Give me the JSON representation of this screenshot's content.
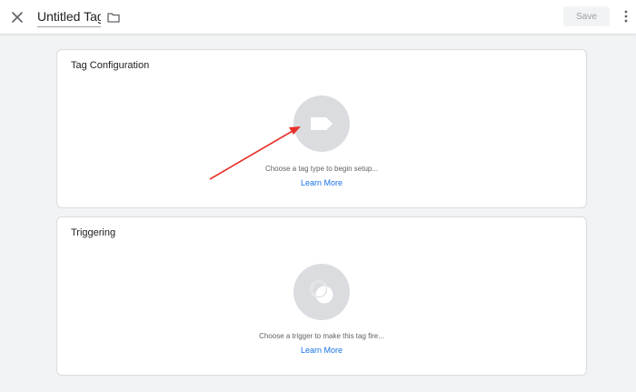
{
  "header": {
    "title": "Untitled Tag",
    "save_label": "Save",
    "icons": {
      "close": "close-icon",
      "folder": "folder-icon",
      "more": "more-vert-icon"
    }
  },
  "tag_configuration": {
    "title": "Tag Configuration",
    "hint": "Choose a tag type to begin setup...",
    "learn_more": "Learn More",
    "icon": "tag-icon"
  },
  "triggering": {
    "title": "Triggering",
    "hint": "Choose a trigger to make this tag fire...",
    "learn_more": "Learn More",
    "icon": "trigger-icon"
  },
  "colors": {
    "background": "#f1f3f4",
    "card": "#ffffff",
    "link": "#1a73e8",
    "placeholder_circle": "#dadce0",
    "annotation_arrow": "#e8312a"
  }
}
